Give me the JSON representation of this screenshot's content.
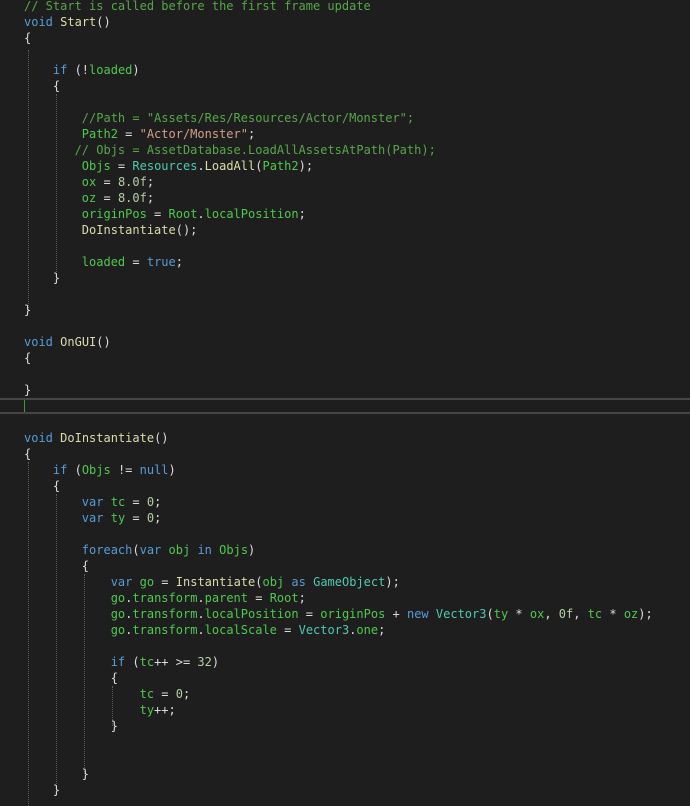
{
  "colors": {
    "comment": "#57a64a",
    "keyword": "#569cd6",
    "method": "#dcdcaa",
    "field": "#4ec94e",
    "plain": "#dcdcdc",
    "string": "#d69d85",
    "type": "#4ec9b0",
    "number": "#b5cea8"
  },
  "code_lines": [
    [
      [
        "comment",
        "// Start is called before the first frame update"
      ]
    ],
    [
      [
        "keyword",
        "void"
      ],
      [
        "plain",
        " "
      ],
      [
        "method",
        "Start"
      ],
      [
        "plain",
        "()"
      ]
    ],
    [
      [
        "plain",
        "{"
      ]
    ],
    [],
    [
      [
        "plain",
        "    "
      ],
      [
        "keyword",
        "if"
      ],
      [
        "plain",
        " (!"
      ],
      [
        "field",
        "loaded"
      ],
      [
        "plain",
        ")"
      ]
    ],
    [
      [
        "plain",
        "    {"
      ]
    ],
    [],
    [
      [
        "plain",
        "        "
      ],
      [
        "comment",
        "//Path = \"Assets/Res/Resources/Actor/Monster\";"
      ]
    ],
    [
      [
        "plain",
        "        "
      ],
      [
        "field",
        "Path2"
      ],
      [
        "plain",
        " = "
      ],
      [
        "string",
        "\"Actor/Monster\""
      ],
      [
        "plain",
        ";"
      ]
    ],
    [
      [
        "plain",
        "       "
      ],
      [
        "comment",
        "// Objs = AssetDatabase.LoadAllAssetsAtPath(Path);"
      ]
    ],
    [
      [
        "plain",
        "        "
      ],
      [
        "field",
        "Objs"
      ],
      [
        "plain",
        " = "
      ],
      [
        "type",
        "Resources"
      ],
      [
        "plain",
        "."
      ],
      [
        "method",
        "LoadAll"
      ],
      [
        "plain",
        "("
      ],
      [
        "field",
        "Path2"
      ],
      [
        "plain",
        ");"
      ]
    ],
    [
      [
        "plain",
        "        "
      ],
      [
        "field",
        "ox"
      ],
      [
        "plain",
        " = "
      ],
      [
        "number",
        "8.0f"
      ],
      [
        "plain",
        ";"
      ]
    ],
    [
      [
        "plain",
        "        "
      ],
      [
        "field",
        "oz"
      ],
      [
        "plain",
        " = "
      ],
      [
        "number",
        "8.0f"
      ],
      [
        "plain",
        ";"
      ]
    ],
    [
      [
        "plain",
        "        "
      ],
      [
        "field",
        "originPos"
      ],
      [
        "plain",
        " = "
      ],
      [
        "field",
        "Root"
      ],
      [
        "plain",
        "."
      ],
      [
        "field",
        "localPosition"
      ],
      [
        "plain",
        ";"
      ]
    ],
    [
      [
        "plain",
        "        "
      ],
      [
        "method",
        "DoInstantiate"
      ],
      [
        "plain",
        "();"
      ]
    ],
    [],
    [
      [
        "plain",
        "        "
      ],
      [
        "field",
        "loaded"
      ],
      [
        "plain",
        " = "
      ],
      [
        "keyword",
        "true"
      ],
      [
        "plain",
        ";"
      ]
    ],
    [
      [
        "plain",
        "    }"
      ]
    ],
    [],
    [
      [
        "plain",
        "}"
      ]
    ],
    [],
    [
      [
        "keyword",
        "void"
      ],
      [
        "plain",
        " "
      ],
      [
        "method",
        "OnGUI"
      ],
      [
        "plain",
        "()"
      ]
    ],
    [
      [
        "plain",
        "{"
      ]
    ],
    [],
    [
      [
        "plain",
        "}"
      ]
    ],
    [],
    [],
    [
      [
        "keyword",
        "void"
      ],
      [
        "plain",
        " "
      ],
      [
        "method",
        "DoInstantiate"
      ],
      [
        "plain",
        "()"
      ]
    ],
    [
      [
        "plain",
        "{"
      ]
    ],
    [
      [
        "plain",
        "    "
      ],
      [
        "keyword",
        "if"
      ],
      [
        "plain",
        " ("
      ],
      [
        "field",
        "Objs"
      ],
      [
        "plain",
        " != "
      ],
      [
        "keyword",
        "null"
      ],
      [
        "plain",
        ")"
      ]
    ],
    [
      [
        "plain",
        "    {"
      ]
    ],
    [
      [
        "plain",
        "        "
      ],
      [
        "keyword",
        "var"
      ],
      [
        "plain",
        " "
      ],
      [
        "field",
        "tc"
      ],
      [
        "plain",
        " = "
      ],
      [
        "number",
        "0"
      ],
      [
        "plain",
        ";"
      ]
    ],
    [
      [
        "plain",
        "        "
      ],
      [
        "keyword",
        "var"
      ],
      [
        "plain",
        " "
      ],
      [
        "field",
        "ty"
      ],
      [
        "plain",
        " = "
      ],
      [
        "number",
        "0"
      ],
      [
        "plain",
        ";"
      ]
    ],
    [],
    [
      [
        "plain",
        "        "
      ],
      [
        "keyword",
        "foreach"
      ],
      [
        "plain",
        "("
      ],
      [
        "keyword",
        "var"
      ],
      [
        "plain",
        " "
      ],
      [
        "field",
        "obj"
      ],
      [
        "plain",
        " "
      ],
      [
        "keyword",
        "in"
      ],
      [
        "plain",
        " "
      ],
      [
        "field",
        "Objs"
      ],
      [
        "plain",
        ")"
      ]
    ],
    [
      [
        "plain",
        "        {"
      ]
    ],
    [
      [
        "plain",
        "            "
      ],
      [
        "keyword",
        "var"
      ],
      [
        "plain",
        " "
      ],
      [
        "field",
        "go"
      ],
      [
        "plain",
        " = "
      ],
      [
        "method",
        "Instantiate"
      ],
      [
        "plain",
        "("
      ],
      [
        "field",
        "obj"
      ],
      [
        "plain",
        " "
      ],
      [
        "keyword",
        "as"
      ],
      [
        "plain",
        " "
      ],
      [
        "type",
        "GameObject"
      ],
      [
        "plain",
        ");"
      ]
    ],
    [
      [
        "plain",
        "            "
      ],
      [
        "field",
        "go"
      ],
      [
        "plain",
        "."
      ],
      [
        "field",
        "transform"
      ],
      [
        "plain",
        "."
      ],
      [
        "field",
        "parent"
      ],
      [
        "plain",
        " = "
      ],
      [
        "field",
        "Root"
      ],
      [
        "plain",
        ";"
      ]
    ],
    [
      [
        "plain",
        "            "
      ],
      [
        "field",
        "go"
      ],
      [
        "plain",
        "."
      ],
      [
        "field",
        "transform"
      ],
      [
        "plain",
        "."
      ],
      [
        "field",
        "localPosition"
      ],
      [
        "plain",
        " = "
      ],
      [
        "field",
        "originPos"
      ],
      [
        "plain",
        " + "
      ],
      [
        "keyword",
        "new"
      ],
      [
        "plain",
        " "
      ],
      [
        "type",
        "Vector3"
      ],
      [
        "plain",
        "("
      ],
      [
        "field",
        "ty"
      ],
      [
        "plain",
        " * "
      ],
      [
        "field",
        "ox"
      ],
      [
        "plain",
        ", "
      ],
      [
        "number",
        "0f"
      ],
      [
        "plain",
        ", "
      ],
      [
        "field",
        "tc"
      ],
      [
        "plain",
        " * "
      ],
      [
        "field",
        "oz"
      ],
      [
        "plain",
        ");"
      ]
    ],
    [
      [
        "plain",
        "            "
      ],
      [
        "field",
        "go"
      ],
      [
        "plain",
        "."
      ],
      [
        "field",
        "transform"
      ],
      [
        "plain",
        "."
      ],
      [
        "field",
        "localScale"
      ],
      [
        "plain",
        " = "
      ],
      [
        "type",
        "Vector3"
      ],
      [
        "plain",
        "."
      ],
      [
        "field",
        "one"
      ],
      [
        "plain",
        ";"
      ]
    ],
    [],
    [
      [
        "plain",
        "            "
      ],
      [
        "keyword",
        "if"
      ],
      [
        "plain",
        " ("
      ],
      [
        "field",
        "tc"
      ],
      [
        "plain",
        "++ >= "
      ],
      [
        "number",
        "32"
      ],
      [
        "plain",
        ")"
      ]
    ],
    [
      [
        "plain",
        "            {"
      ]
    ],
    [
      [
        "plain",
        "                "
      ],
      [
        "field",
        "tc"
      ],
      [
        "plain",
        " = "
      ],
      [
        "number",
        "0"
      ],
      [
        "plain",
        ";"
      ]
    ],
    [
      [
        "plain",
        "                "
      ],
      [
        "field",
        "ty"
      ],
      [
        "plain",
        "++;"
      ]
    ],
    [
      [
        "plain",
        "            }"
      ]
    ],
    [],
    [],
    [
      [
        "plain",
        "        }"
      ]
    ],
    [
      [
        "plain",
        "    }"
      ]
    ]
  ]
}
